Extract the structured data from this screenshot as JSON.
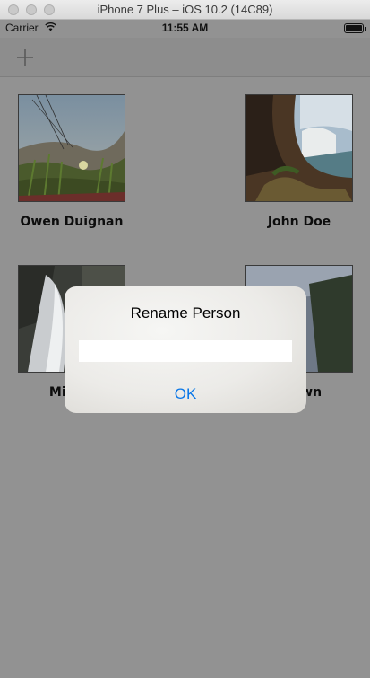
{
  "window": {
    "title": "iPhone 7 Plus – iOS 10.2 (14C89)"
  },
  "status_bar": {
    "carrier": "Carrier",
    "time": "11:55 AM"
  },
  "nav": {
    "add_icon": "plus-icon"
  },
  "people": [
    {
      "name": "Owen Duignan"
    },
    {
      "name": "John Doe"
    },
    {
      "name": "Mister"
    },
    {
      "name": "Brown"
    }
  ],
  "alert": {
    "title": "Rename Person",
    "field_value": "",
    "ok_label": "OK"
  },
  "colors": {
    "accent": "#0a77e8",
    "dim_background": "#929292"
  }
}
